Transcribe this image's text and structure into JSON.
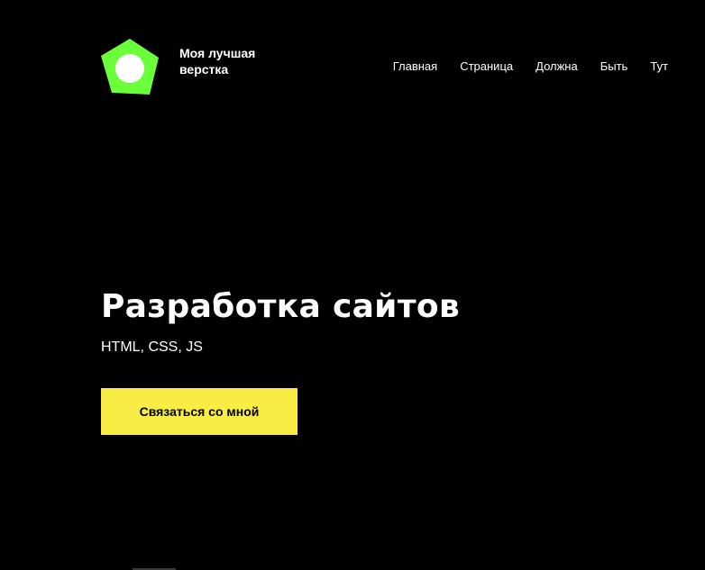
{
  "logo": {
    "icon": "green-pentagon-logo-icon",
    "text": "Моя лучшая верстка",
    "accent_color": "#6aff3a"
  },
  "nav": {
    "items": [
      {
        "label": "Главная"
      },
      {
        "label": "Страница"
      },
      {
        "label": "Должна"
      },
      {
        "label": "Быть"
      },
      {
        "label": "Тут"
      }
    ]
  },
  "hero": {
    "title": "Разработка сайтов",
    "subtitle": "HTML, CSS, JS",
    "cta_label": "Связаться со мной",
    "cta_color": "#f9ec45"
  },
  "colors": {
    "background": "#000000",
    "text": "#ffffff"
  }
}
